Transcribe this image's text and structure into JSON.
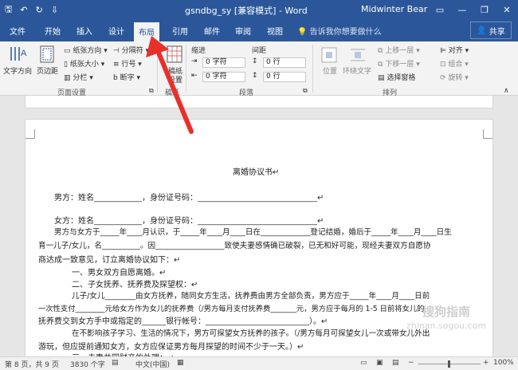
{
  "titlebar": {
    "doc_title": "gsndbg_sy [兼容模式] - Word",
    "user": "Midwinter Bear",
    "qat_save": "🖫",
    "qat_undo": "↶",
    "qat_redo": "↻",
    "qat_more": "⇩",
    "minimize": "—",
    "restore": "❐",
    "close": "✕",
    "ribbon_display": "▭"
  },
  "tabs": [
    "文件",
    "开始",
    "插入",
    "设计",
    "布局",
    "引用",
    "邮件",
    "审阅",
    "视图"
  ],
  "tell_me": "告诉我你想要做什么",
  "share": "共享",
  "ribbon": {
    "text_direction": "文字方向",
    "margins": "页边距",
    "orientation": "纸张方向",
    "size": "纸张大小",
    "columns": "分栏",
    "breaks": "分隔符",
    "line_numbers": "行号",
    "hyphenation": "断字",
    "page_setup_label": "页面设置",
    "paper": "稿纸",
    "paper2": "设置",
    "paper_label": "稿纸",
    "indent_label": "缩进",
    "spacing_label": "间距",
    "indent_left": "0 字符",
    "indent_right": "0 字符",
    "space_before": "0 行",
    "space_after": "0 行",
    "paragraph_label": "段落",
    "position": "位置",
    "wrap_text": "环绕文字",
    "bring_forward": "上移一层",
    "send_backward": "下移一层",
    "selection_pane": "选择窗格",
    "align": "对齐",
    "group": "组合",
    "rotate": "旋转",
    "arrange_label": "排列"
  },
  "document": {
    "title": "离婚协议书↵",
    "lines": [
      "男方：姓名____________，身份证号码：______________________________↵",
      "女方：姓名____________，身份证号码：______________________________↵",
      "男方与女方于_____年____月认识，于_____年____月____日在_____________登记结婚，婚后于_____年____月____日生",
      "育一儿子/女儿，名__________。因__________________致使夫妻感情确已破裂，已无和好可能，现经夫妻双方自愿协",
      "商达成一致意见，订立离婚协议如下：↵",
      "一、男女双方自愿离婚。↵",
      "二、子女抚养、抚养费及探望权：↵",
      "儿子/女儿________由女方抚养，随同女方生活，抚养费由男方全部负责，男方应于_____年____月____日前",
      "一次性支付________元给女方作为女儿的抚养费（/男方每月支付抚养费_______元，男方应于每月的 1-5 日前将女儿的",
      "抚养费交到女方手中或指定的______银行帐号：__________________________）。↵",
      "在不影响孩子学习、生活的情况下，男方可探望女方抚养的孩子。（/男方每月可探望女儿一次或带女儿外出",
      "游玩，但应提前通知女方，女方应保证男方每月探望的时间不少于一天。）↵",
      "三、夫妻共同财产的处理：↵"
    ]
  },
  "status": {
    "page": "第 8 页，共 9 页",
    "words": "3830 个字",
    "lang": "中文(中国)",
    "zoom": "100%"
  },
  "watermark": {
    "line1": "搜狗指南",
    "line2": "zhinan.sogou.com"
  },
  "colors": {
    "accent": "#2b579a",
    "arrow": "#e8302a"
  }
}
